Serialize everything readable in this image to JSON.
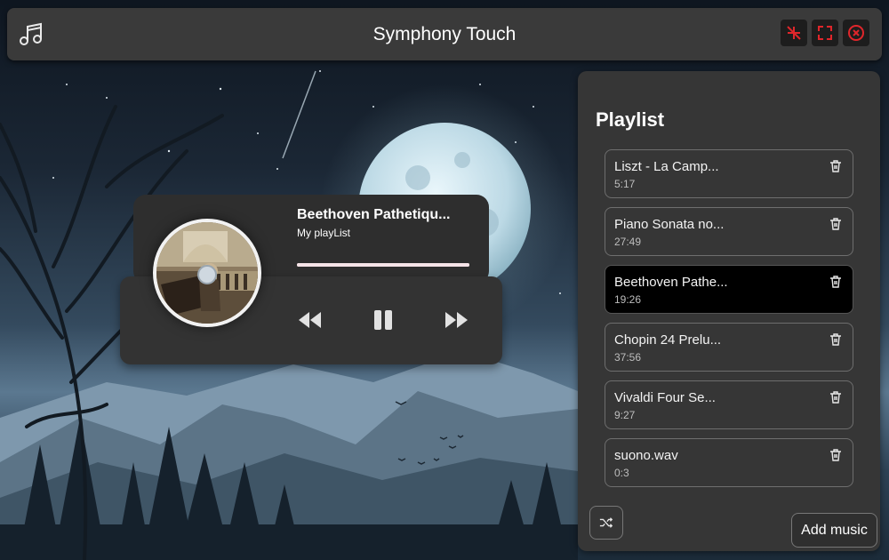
{
  "window": {
    "title": "Symphony Touch",
    "app_icon": "music-note-icon",
    "controls": [
      "minimize-icon",
      "fullscreen-icon",
      "close-icon"
    ],
    "accent_color": "#e0262b"
  },
  "player": {
    "now_playing_title": "Beethoven Pathetiqu...",
    "playlist_name": "My playList",
    "progress_fraction": 1.0,
    "controls": {
      "previous": "rewind-icon",
      "pause": "pause-icon",
      "next": "fast-forward-icon"
    }
  },
  "playlist": {
    "heading": "Playlist",
    "tracks": [
      {
        "name": "Liszt - La Camp...",
        "duration": "5:17",
        "active": false
      },
      {
        "name": "Piano Sonata no...",
        "duration": "27:49",
        "active": false
      },
      {
        "name": "Beethoven Pathe...",
        "duration": "19:26",
        "active": true
      },
      {
        "name": "Chopin 24 Prelu...",
        "duration": "37:56",
        "active": false
      },
      {
        "name": "Vivaldi Four Se...",
        "duration": "9:27",
        "active": false
      },
      {
        "name": "suono.wav",
        "duration": "0:3",
        "active": false
      }
    ],
    "shuffle_icon": "shuffle-icon",
    "add_music_label": "Add music"
  }
}
